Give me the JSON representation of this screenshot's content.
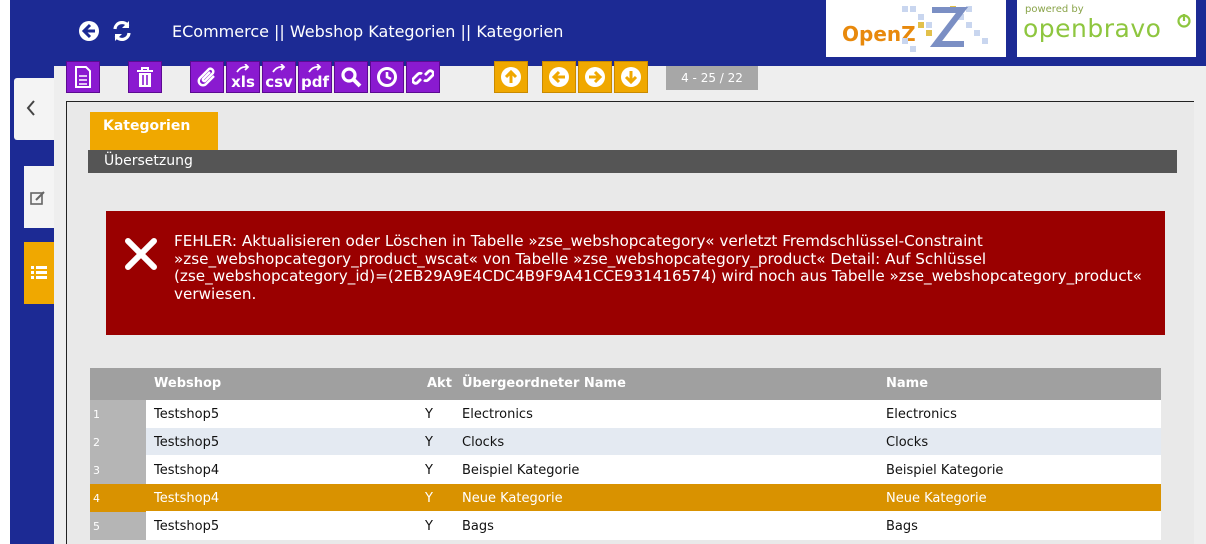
{
  "header": {
    "breadcrumb": "ECommerce || Webshop Kategorien || Kategorien",
    "logo_openz": "OpenZ",
    "powered_by": "powered by",
    "openbravo": "openbravo"
  },
  "toolbar": {
    "export_xls": "xls",
    "export_csv": "csv",
    "export_pdf": "pdf",
    "pager": "4 - 25 / 22"
  },
  "tabs": {
    "main_tab": "Kategorien",
    "sub_tab": "Übersetzung"
  },
  "error": {
    "message": "FEHLER: Aktualisieren oder Löschen in Tabelle »zse_webshopcategory« verletzt Fremdschlüssel-Constraint »zse_webshopcategory_product_wscat« von Tabelle »zse_webshopcategory_product« Detail: Auf Schlüssel (zse_webshopcategory_id)=(2EB29A9E4CDC4B9F9A41CCE931416574) wird noch aus Tabelle »zse_webshopcategory_product« verwiesen."
  },
  "grid": {
    "columns": [
      "Webshop",
      "Akt",
      "Übergeordneter Name",
      "Name"
    ],
    "rows": [
      {
        "num": "1",
        "webshop": "Testshop5",
        "akt": "Y",
        "parent": "Electronics",
        "name": "Electronics"
      },
      {
        "num": "2",
        "webshop": "Testshop5",
        "akt": "Y",
        "parent": "Clocks",
        "name": "Clocks"
      },
      {
        "num": "3",
        "webshop": "Testshop4",
        "akt": "Y",
        "parent": "Beispiel Kategorie",
        "name": "Beispiel Kategorie"
      },
      {
        "num": "4",
        "webshop": "Testshop4",
        "akt": "Y",
        "parent": "Neue Kategorie",
        "name": "Neue Kategorie"
      },
      {
        "num": "5",
        "webshop": "Testshop5",
        "akt": "Y",
        "parent": "Bags",
        "name": "Bags"
      }
    ],
    "selected_row": 4
  },
  "colors": {
    "nav_blue": "#1c2a94",
    "toolbar_purple": "#8a1ad0",
    "accent_orange": "#f0a800",
    "error_red": "#9a0000"
  }
}
